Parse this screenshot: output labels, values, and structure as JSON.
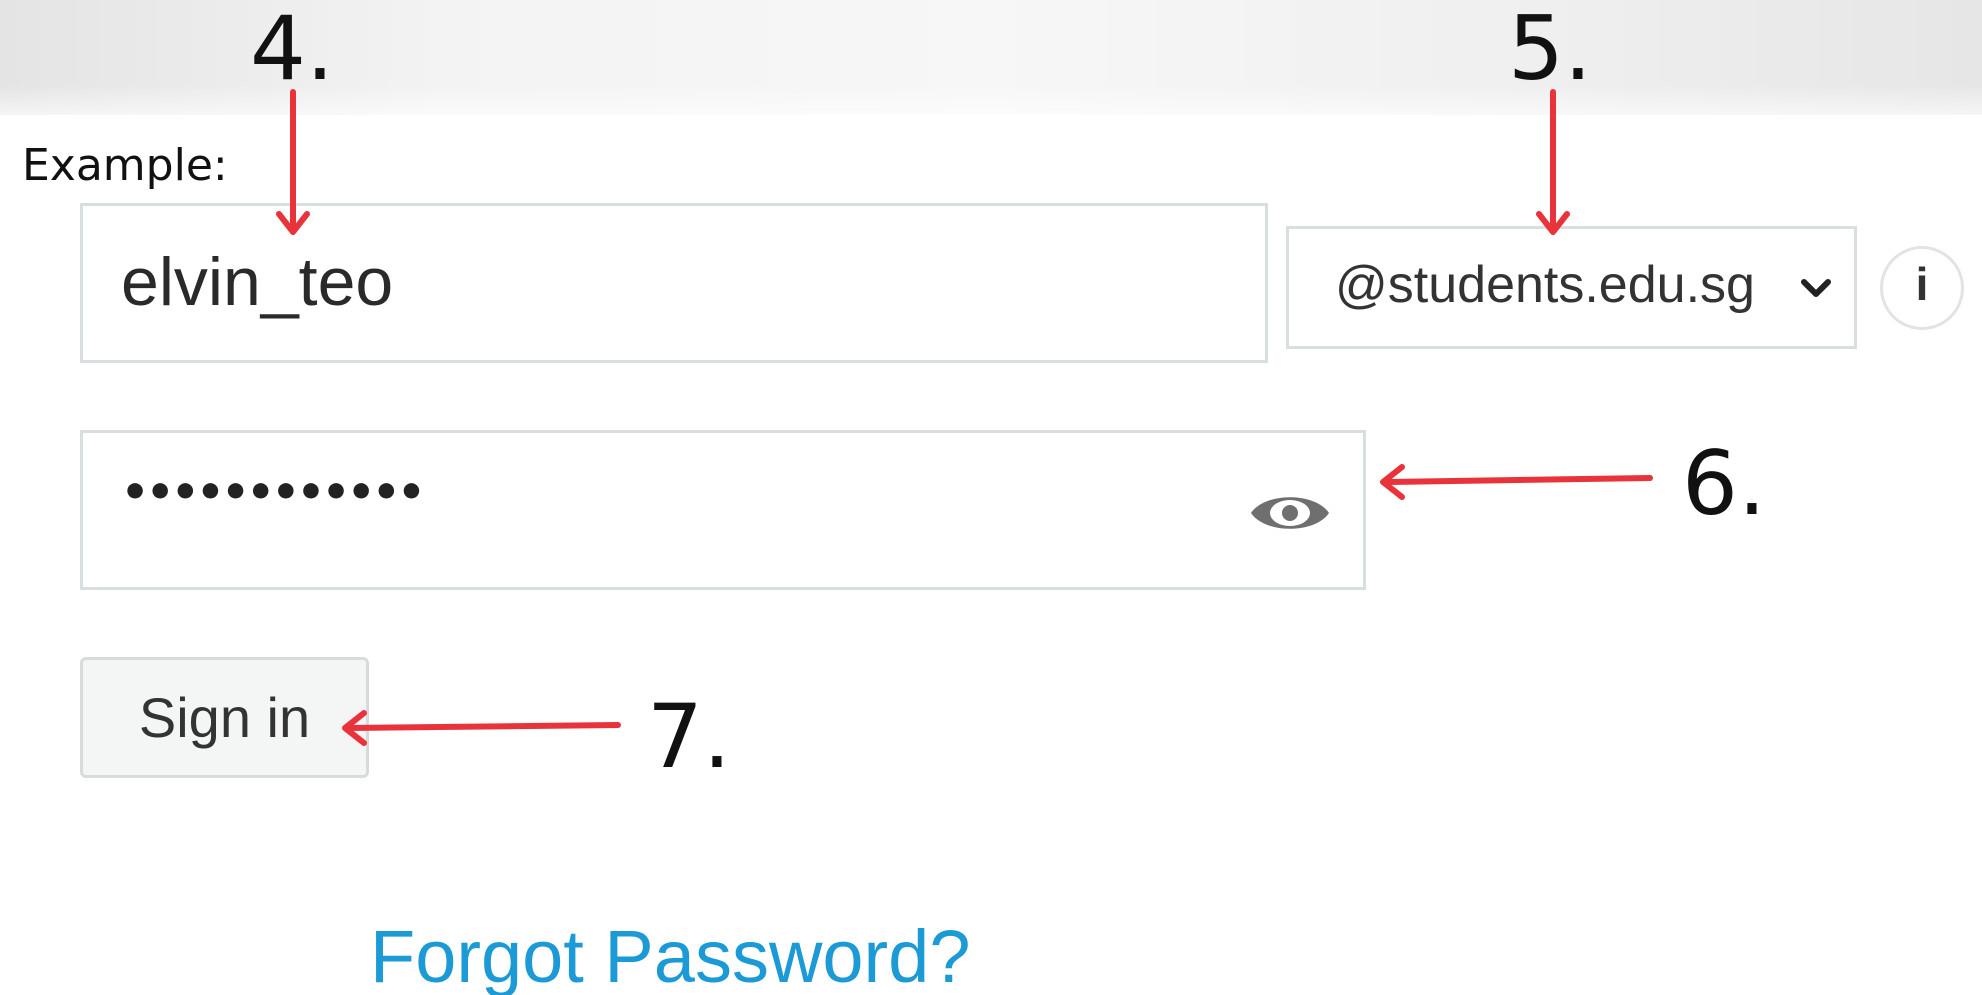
{
  "instruction": {
    "example_label": "Example:"
  },
  "steps": [
    "4.",
    "5.",
    "6.",
    "7."
  ],
  "login_form": {
    "username_value": "elvin_teo",
    "domain_selected": "@students.edu.sg",
    "info_icon_glyph": "i",
    "password_masked": "••••••••••••",
    "signin_label": "Sign in",
    "forgot_password_label": "Forgot Password?"
  },
  "icons": {
    "domain_dropdown": "chevron-down-icon",
    "info": "info-icon",
    "password_toggle": "eye-icon",
    "annotation": "arrow-icon"
  },
  "colors": {
    "annotation_arrow": "#e8333a",
    "link": "#1c9ad6",
    "field_border": "#d9dfe0",
    "button_background": "#f4f6f6"
  }
}
